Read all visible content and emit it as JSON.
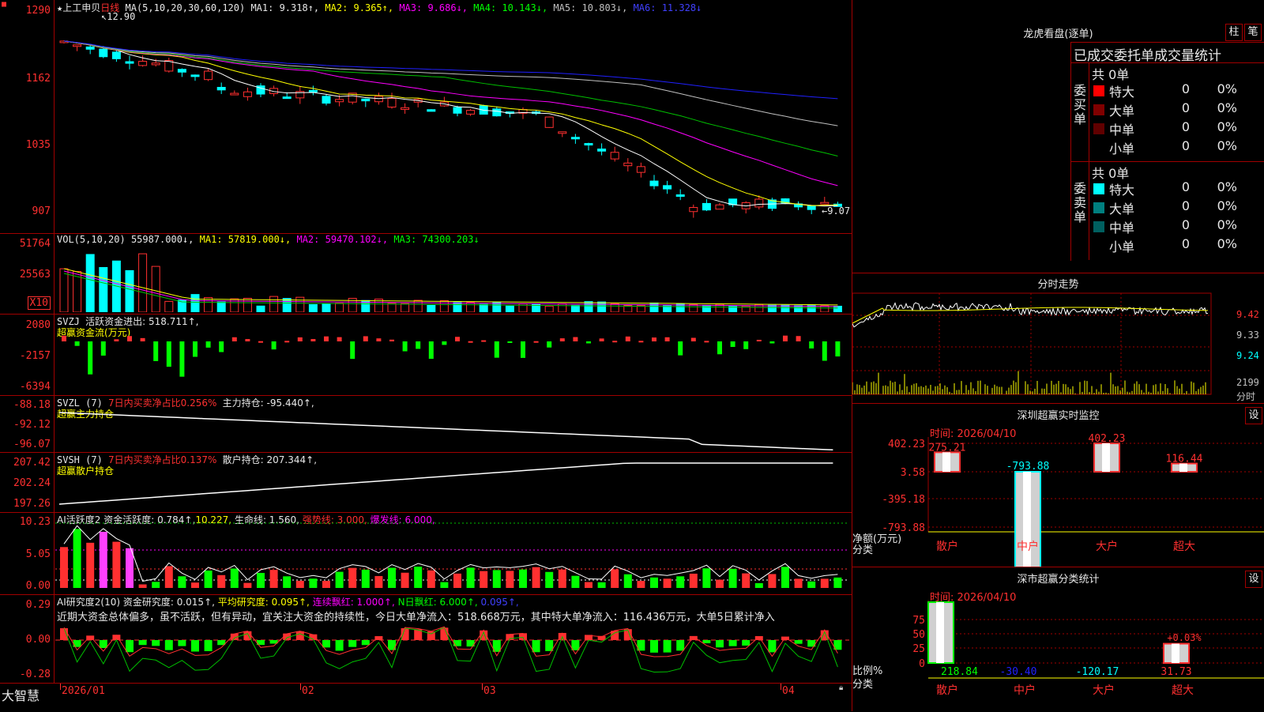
{
  "colors": {
    "up": "#ff3030",
    "down": "#00ffff",
    "ma1": "#ffffff",
    "ma2": "#ffff00",
    "ma3": "#ff00ff",
    "ma4": "#00c000",
    "ma5": "#c0c0c0",
    "ma6": "#2020ff",
    "grid": "#a00000"
  },
  "kline": {
    "stock_name": "上工申贝",
    "period": "日线",
    "ma_label": "MA(5,10,20,30,60,120)",
    "ma1": "MA1: 9.318↑,",
    "ma2": "MA2: 9.365↑,",
    "ma3": "MA3: 9.686↓,",
    "ma4": "MA4: 10.143↓,",
    "ma5": "MA5: 10.803↓,",
    "ma6": "MA6: 11.328↓",
    "high_label": "12.90",
    "low_label": "9.07",
    "ticks": [
      "1290",
      "1162",
      "1035",
      "907"
    ]
  },
  "vol": {
    "label": "VOL(5,10,20)",
    "value": "55987.000↓,",
    "ma1": "MA1: 57819.000↓,",
    "ma2": "MA2: 59470.102↓,",
    "ma3": "MA3: 74300.203↓",
    "ticks": [
      "51764",
      "25563"
    ],
    "unit": "X10"
  },
  "svzj": {
    "label": "SVZJ",
    "text1": "活跃资金进出: 518.711↑,",
    "text2": "超赢资金流(万元)",
    "ticks": [
      "2080",
      "-2157",
      "-6394"
    ]
  },
  "svzl": {
    "label": "SVZL (7)",
    "t1": "7日内买卖净占比0.256%",
    "t2": "主力持仓: -95.440↑,",
    "t3": "超赢主力持仓",
    "ticks": [
      "-88.18",
      "-92.12",
      "-96.07"
    ]
  },
  "svsh": {
    "label": "SVSH (7)",
    "t1": "7日内买卖净占比0.137%",
    "t2": "散户持仓: 207.344↑,",
    "t3": "超赢散户持仓",
    "ticks": [
      "207.42",
      "202.24",
      "197.26"
    ]
  },
  "aihy": {
    "label": "AI活跃度2",
    "t1": "资金活跃度: 0.784↑,",
    "t2": "10.227,",
    "t3": "生命线: 1.560,",
    "t4": "强势线: 3.000,",
    "t5": "爆发线: 6.000,",
    "ticks": [
      "10.23",
      "5.05",
      "0.00"
    ]
  },
  "aiyj": {
    "label": "AI研究度2(10)",
    "t1": "资金研究度: 0.015↑,",
    "t2": "平均研究度: 0.095↑,",
    "t3": "连续飘红: 1.000↑,",
    "t4": "N日飘红: 6.000↑,",
    "t5": "0.095↑,",
    "comment": "近期大资金总体偏多，虽不活跃，但有异动，宜关注大资金的持续性，今日大单净流入：518.668万元，其中特大单净流入：116.436万元，大单5日累计净入",
    "ticks": [
      "0.29",
      "0.00",
      "-0.28"
    ]
  },
  "xaxis": {
    "labels": [
      "2026/01",
      "02",
      "03",
      "04"
    ]
  },
  "footer": {
    "brand": "大智慧"
  },
  "longhu": {
    "title": "龙虎看盘(逐单)",
    "btn1": "柱",
    "btn2": "笔",
    "subtitle": "已成交委托单成交量统计",
    "buy_side": "委买单",
    "sell_side": "委卖单",
    "buy_total": "共 0单",
    "sell_total": "共 0单",
    "buy_rows": [
      {
        "name": "特大",
        "count": "0",
        "pct": "0%"
      },
      {
        "name": "大单",
        "count": "0",
        "pct": "0%"
      },
      {
        "name": "中单",
        "count": "0",
        "pct": "0%"
      },
      {
        "name": "小单",
        "count": "0",
        "pct": "0%"
      }
    ],
    "sell_rows": [
      {
        "name": "特大",
        "count": "0",
        "pct": "0%"
      },
      {
        "name": "大单",
        "count": "0",
        "pct": "0%"
      },
      {
        "name": "中单",
        "count": "0",
        "pct": "0%"
      },
      {
        "name": "小单",
        "count": "0",
        "pct": "0%"
      }
    ]
  },
  "fenshi": {
    "title": "分时走势",
    "ticks": [
      "9.42",
      "9.33",
      "9.24",
      "2199",
      "分时"
    ]
  },
  "sz_monitor": {
    "title": "深圳超赢实时监控",
    "settings": "设",
    "time": "时间: 2026/04/10",
    "ticks": [
      "402.23",
      "3.58",
      "-395.18",
      "-793.88"
    ],
    "ylabel": "净额(万元)",
    "xlabel": "分类",
    "cats": [
      "散户",
      "中户",
      "大户",
      "超大"
    ],
    "values": [
      275.21,
      -793.88,
      402.23,
      116.44
    ],
    "labels": [
      "275.21",
      "-793.88",
      "402.23",
      "116.44"
    ]
  },
  "sz_category": {
    "title": "深市超赢分类统计",
    "settings": "设",
    "time": "时间: 2026/04/10",
    "ticks": [
      "75",
      "50",
      "25",
      "0"
    ],
    "ylabel": "比例%",
    "xlabel": "分类",
    "cats": [
      "散户",
      "中户",
      "大户",
      "超大"
    ],
    "values": [
      "218.84",
      "-30.40",
      "-120.17",
      "31.73"
    ],
    "pct_label": "+0.03%",
    "bar_ratios": [
      100,
      0,
      0,
      31.73
    ]
  }
}
